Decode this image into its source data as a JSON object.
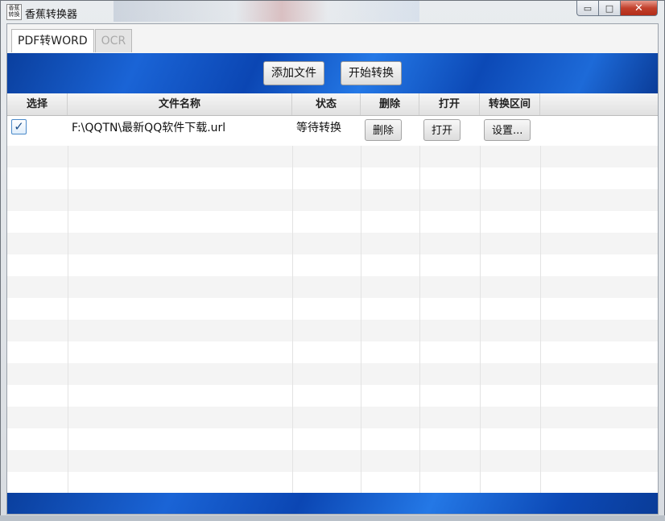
{
  "window": {
    "title": "香蕉转换器",
    "icon_text": "香蕉转换",
    "controls": {
      "minimize": "▭",
      "maximize": "□",
      "close": "✕"
    }
  },
  "tabs": [
    {
      "label": "PDF转WORD",
      "active": true
    },
    {
      "label": "OCR",
      "active": false
    }
  ],
  "toolbar": {
    "add_file_label": "添加文件",
    "start_convert_label": "开始转换"
  },
  "table": {
    "columns": [
      "选择",
      "文件名称",
      "状态",
      "删除",
      "打开",
      "转换区间"
    ],
    "rows": [
      {
        "checked": true,
        "check_glyph": "✓",
        "file_name": "F:\\QQTN\\最新QQ软件下载.url",
        "status": "等待转换",
        "delete_label": "删除",
        "open_label": "打开",
        "range_label": "设置..."
      }
    ]
  },
  "colors": {
    "banner_blue": "#1a64d6",
    "checkbox_border": "#4a89c9"
  }
}
